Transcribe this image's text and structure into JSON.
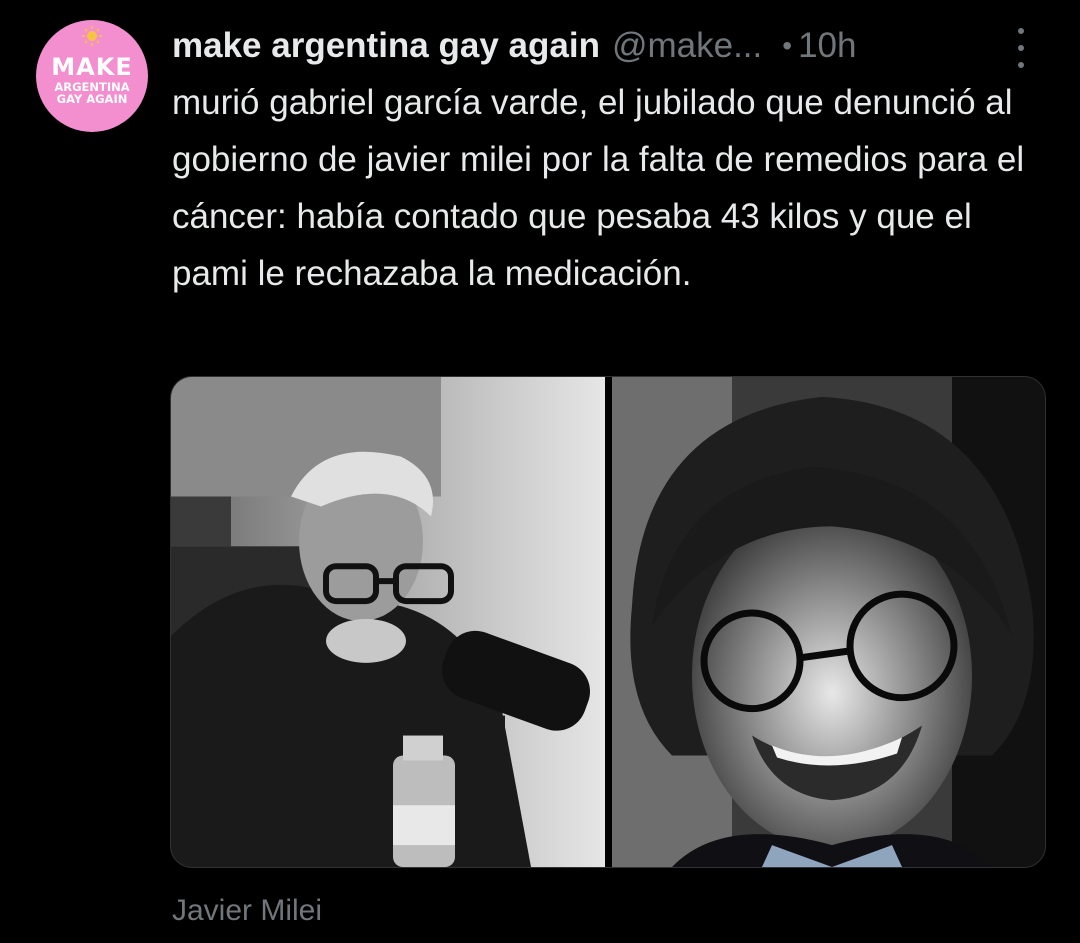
{
  "tweet": {
    "avatar": {
      "logo_line1": "MAKE",
      "logo_line2": "ARGENTINA",
      "logo_line3": "GAY AGAIN",
      "background_color": "#f38ecf"
    },
    "display_name": "make argentina gay again",
    "handle": "@make...",
    "separator": "•",
    "time": "10h",
    "more_icon": "more-vertical-icon",
    "text": "murió gabriel garcía varde, el jubilado que denunció al gobierno de javier milei por la falta de remedios para el cáncer: había contado que pesaba 43 kilos y que el pami le rechazaba la medicación.",
    "media": [
      {
        "description": "black and white photo of an elderly man with glasses in front of a microphone"
      },
      {
        "description": "photo of a smiling man with curly hair and round glasses"
      }
    ],
    "caption": "Javier Milei"
  },
  "colors": {
    "background": "#000000",
    "text_primary": "#e7e9ea",
    "text_secondary": "#71767b",
    "border": "#2f3336"
  }
}
